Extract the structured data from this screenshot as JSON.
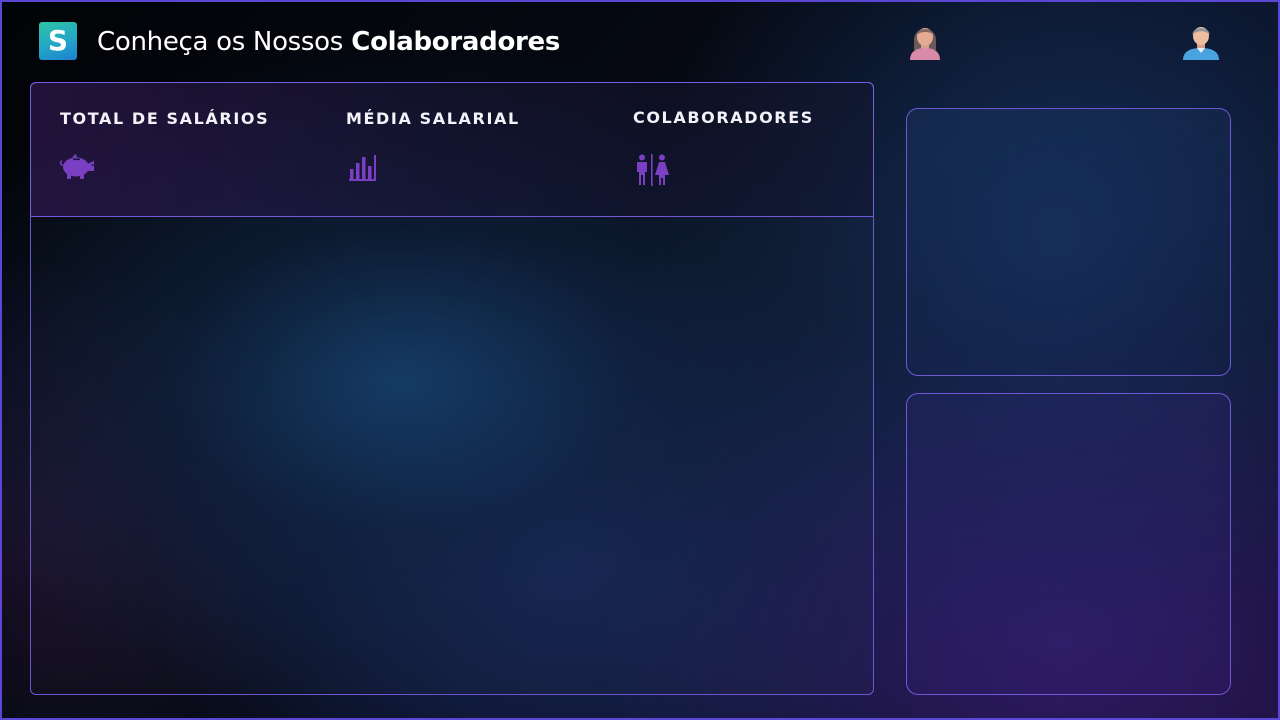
{
  "header": {
    "logo_letter": "S",
    "title_prefix": "Conheça os Nossos",
    "title_emphasis": "Colaboradores",
    "avatars": [
      "female-user-avatar",
      "male-user-avatar"
    ]
  },
  "kpis": [
    {
      "label": "TOTAL DE SALÁRIOS",
      "icon": "piggy-bank-icon"
    },
    {
      "label": "MÉDIA SALARIAL",
      "icon": "bar-chart-icon"
    },
    {
      "label": "COLABORADORES",
      "icon": "male-female-icon"
    }
  ],
  "colors": {
    "accent_border": "#7c62eb",
    "icon_purple": "#7b3fc4",
    "logo_gradient_start": "#2ec4a2",
    "logo_gradient_end": "#1c7fd0",
    "text": "#ffffff"
  }
}
